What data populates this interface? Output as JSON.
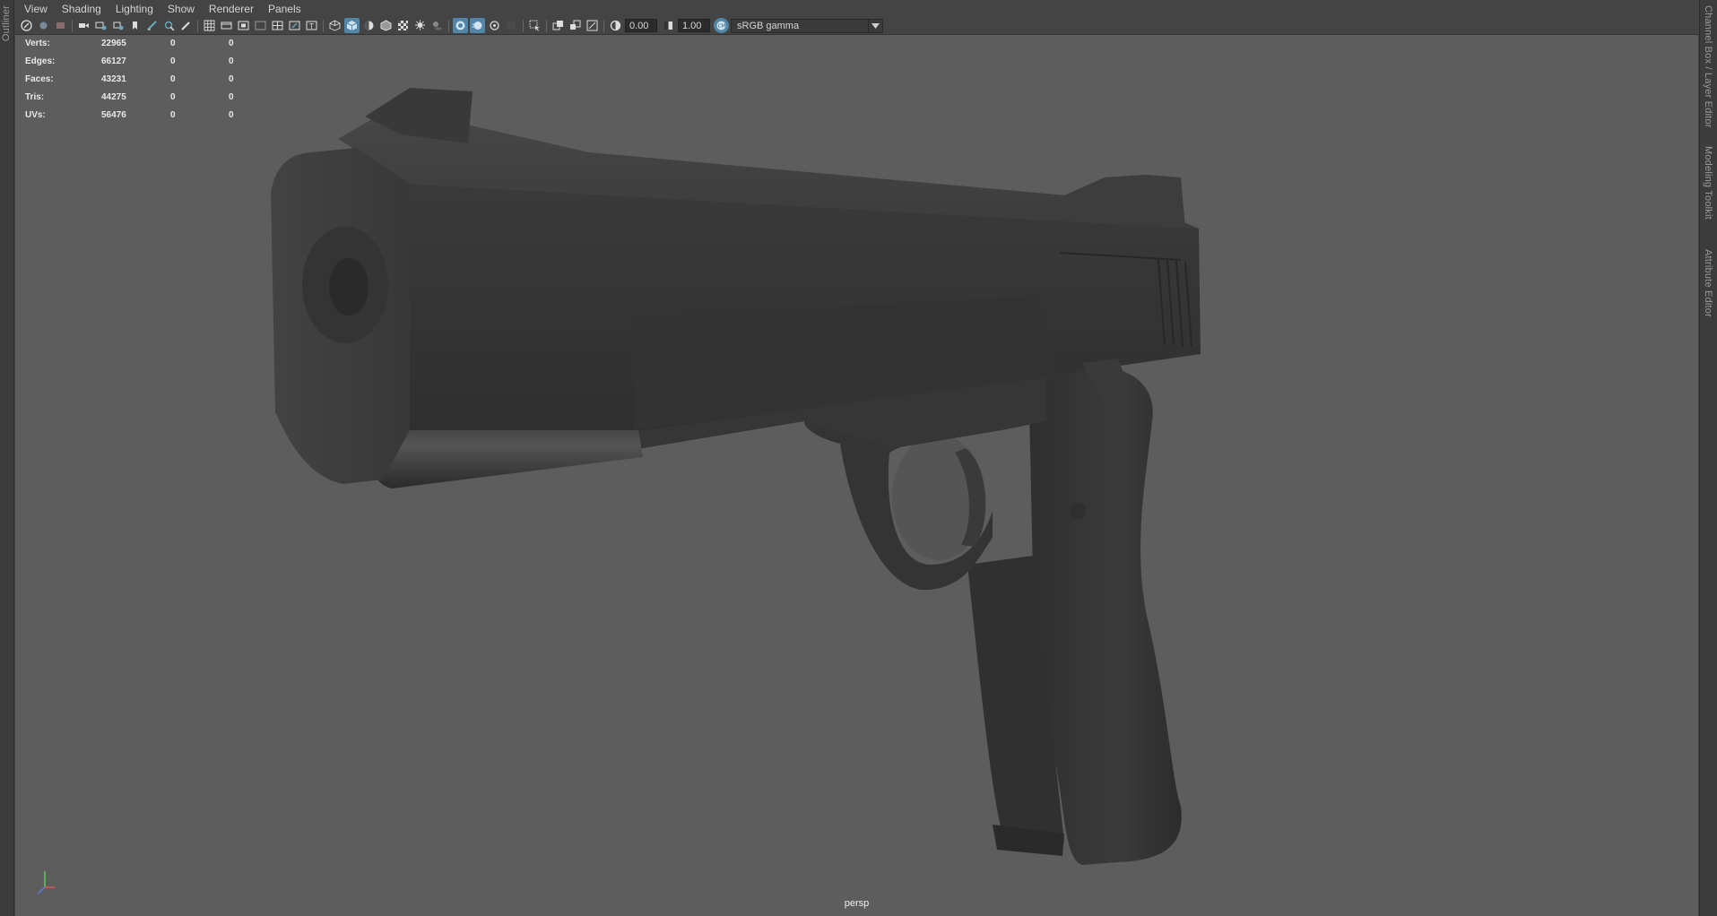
{
  "panels": {
    "left": {
      "outliner_label": "Outliner"
    },
    "right": {
      "tabs": [
        "Channel Box / Layer Editor",
        "Modeling Toolkit",
        "Attribute Editor"
      ]
    }
  },
  "menubar": {
    "items": [
      "View",
      "Shading",
      "Lighting",
      "Show",
      "Renderer",
      "Panels"
    ]
  },
  "toolbar": {
    "exposure_value": "0.00",
    "gamma_value": "1.00",
    "color_management": "sRGB gamma"
  },
  "hud": {
    "rows": [
      {
        "label": "Verts:",
        "v1": "22965",
        "v2": "0",
        "v3": "0"
      },
      {
        "label": "Edges:",
        "v1": "66127",
        "v2": "0",
        "v3": "0"
      },
      {
        "label": "Faces:",
        "v1": "43231",
        "v2": "0",
        "v3": "0"
      },
      {
        "label": "Tris:",
        "v1": "44275",
        "v2": "0",
        "v3": "0"
      },
      {
        "label": "UVs:",
        "v1": "56476",
        "v2": "0",
        "v3": "0"
      }
    ]
  },
  "viewport": {
    "camera": "persp",
    "model": "pistol-model"
  },
  "colors": {
    "viewport_bg": "#5d5d5d",
    "ui_bg": "#444444",
    "active_button": "#5285a6",
    "model": "#3a3a3a"
  }
}
